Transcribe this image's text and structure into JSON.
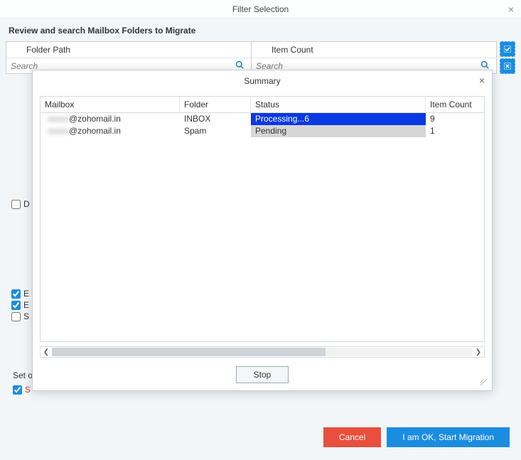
{
  "titlebar": {
    "title": "Filter Selection"
  },
  "subheader": "Review and search Mailbox Folders to Migrate",
  "folderCols": {
    "left": {
      "header": "Folder Path",
      "placeholder": "Search"
    },
    "right": {
      "header": "Item Count",
      "placeholder": "Search"
    }
  },
  "leftOptions": {
    "d": {
      "checked": false,
      "label": "D"
    },
    "e1": {
      "checked": true,
      "label": "E"
    },
    "e2": {
      "checked": true,
      "label": "E"
    },
    "s": {
      "checked": false,
      "label": "S"
    }
  },
  "setLabel": "Set o",
  "redOpt": {
    "checked": true,
    "label": "S"
  },
  "footer": {
    "cancel": "Cancel",
    "ok": "I am OK, Start Migration"
  },
  "modal": {
    "title": "Summary",
    "headers": {
      "mailbox": "Mailbox",
      "folder": "Folder",
      "status": "Status",
      "count": "Item Count"
    },
    "rows": [
      {
        "mailbox_obscured": "xxxxx",
        "mailbox_domain": "@zohomail.in",
        "folder": "INBOX",
        "status": "Processing...6",
        "status_type": "processing",
        "count": "9"
      },
      {
        "mailbox_obscured": "xxxxx",
        "mailbox_domain": "@zohomail.in",
        "folder": "Spam",
        "status": "Pending",
        "status_type": "pending",
        "count": "1"
      }
    ],
    "stop": "Stop"
  }
}
